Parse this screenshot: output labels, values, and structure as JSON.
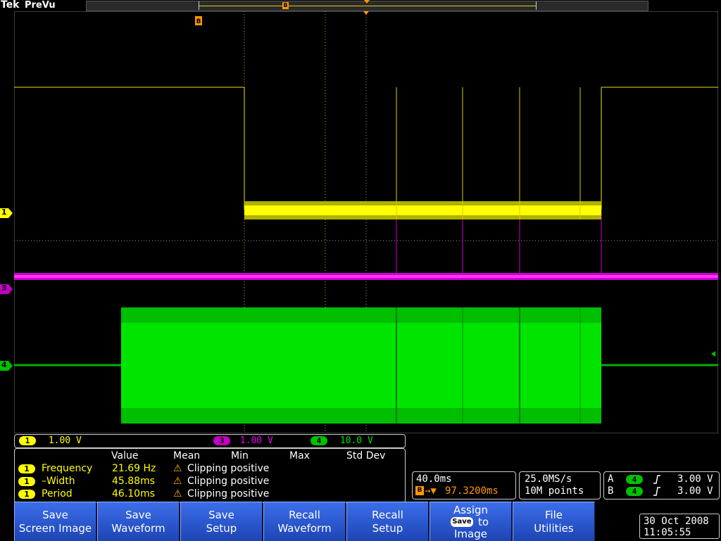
{
  "status": {
    "brand": "Tek",
    "mode": "PreVu"
  },
  "record_marker": "B",
  "screen_marker": "B",
  "channels": [
    {
      "num": "1",
      "color": "#ffff00"
    },
    {
      "num": "3",
      "color": "#e600e6"
    },
    {
      "num": "4",
      "color": "#00e000"
    }
  ],
  "legend": {
    "ch1": {
      "num": "1",
      "scale": "1.00 V"
    },
    "ch3": {
      "num": "3",
      "scale": "1.00 V"
    },
    "ch4": {
      "num": "4",
      "scale": "10.0 V"
    }
  },
  "measurements": {
    "headers": [
      "Value",
      "Mean",
      "Min",
      "Max",
      "Std Dev"
    ],
    "rows": [
      {
        "ch": "1",
        "name": "Frequency",
        "value": "21.69 Hz",
        "warning": "Clipping positive"
      },
      {
        "ch": "1",
        "name": "–Width",
        "value": "45.88ms",
        "warning": "Clipping positive"
      },
      {
        "ch": "1",
        "name": "Period",
        "value": "46.10ms",
        "warning": "Clipping positive"
      }
    ]
  },
  "horizontal": {
    "scale": "40.0ms",
    "delay_marker": "B",
    "delay": "97.3200ms"
  },
  "acquisition": {
    "sample_rate": "25.0MS/s",
    "record_length": "10M points"
  },
  "trigger": {
    "a": {
      "label": "A",
      "source": "4",
      "level": "3.00 V"
    },
    "b": {
      "label": "B",
      "source": "4",
      "level": "3.00 V"
    }
  },
  "buttons": [
    {
      "l1": "Save",
      "l2": "Screen Image"
    },
    {
      "l1": "Save",
      "l2": "Waveform"
    },
    {
      "l1": "Save",
      "l2": "Setup"
    },
    {
      "l1": "Recall",
      "l2": "Waveform"
    },
    {
      "l1": "Recall",
      "l2": "Setup"
    },
    {
      "l1": "Assign",
      "badge": "Save",
      "to": "to",
      "l2": "Image"
    },
    {
      "l1": "File",
      "l2": "Utilities"
    }
  ],
  "datetime": {
    "date": "30 Oct  2008",
    "time": "11:05:55"
  },
  "colors": {
    "ch1": "#ffff00",
    "ch3": "#e600e6",
    "ch4": "#00e000",
    "accent": "#ff9900",
    "button": "#2f5fd8"
  },
  "icons": {
    "warning": "warning-triangle-icon",
    "trigger_slope": "rising-edge-icon"
  }
}
